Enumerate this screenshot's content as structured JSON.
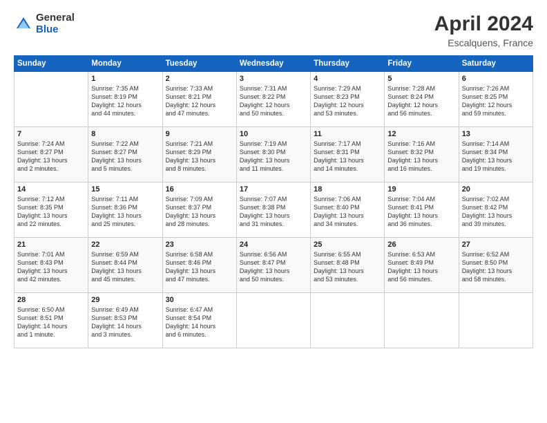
{
  "header": {
    "logo_general": "General",
    "logo_blue": "Blue",
    "month_title": "April 2024",
    "location": "Escalquens, France"
  },
  "days_of_week": [
    "Sunday",
    "Monday",
    "Tuesday",
    "Wednesday",
    "Thursday",
    "Friday",
    "Saturday"
  ],
  "weeks": [
    [
      {
        "day": "",
        "info": ""
      },
      {
        "day": "1",
        "info": "Sunrise: 7:35 AM\nSunset: 8:19 PM\nDaylight: 12 hours\nand 44 minutes."
      },
      {
        "day": "2",
        "info": "Sunrise: 7:33 AM\nSunset: 8:21 PM\nDaylight: 12 hours\nand 47 minutes."
      },
      {
        "day": "3",
        "info": "Sunrise: 7:31 AM\nSunset: 8:22 PM\nDaylight: 12 hours\nand 50 minutes."
      },
      {
        "day": "4",
        "info": "Sunrise: 7:29 AM\nSunset: 8:23 PM\nDaylight: 12 hours\nand 53 minutes."
      },
      {
        "day": "5",
        "info": "Sunrise: 7:28 AM\nSunset: 8:24 PM\nDaylight: 12 hours\nand 56 minutes."
      },
      {
        "day": "6",
        "info": "Sunrise: 7:26 AM\nSunset: 8:25 PM\nDaylight: 12 hours\nand 59 minutes."
      }
    ],
    [
      {
        "day": "7",
        "info": "Sunrise: 7:24 AM\nSunset: 8:27 PM\nDaylight: 13 hours\nand 2 minutes."
      },
      {
        "day": "8",
        "info": "Sunrise: 7:22 AM\nSunset: 8:27 PM\nDaylight: 13 hours\nand 5 minutes."
      },
      {
        "day": "9",
        "info": "Sunrise: 7:21 AM\nSunset: 8:29 PM\nDaylight: 13 hours\nand 8 minutes."
      },
      {
        "day": "10",
        "info": "Sunrise: 7:19 AM\nSunset: 8:30 PM\nDaylight: 13 hours\nand 11 minutes."
      },
      {
        "day": "11",
        "info": "Sunrise: 7:17 AM\nSunset: 8:31 PM\nDaylight: 13 hours\nand 14 minutes."
      },
      {
        "day": "12",
        "info": "Sunrise: 7:16 AM\nSunset: 8:32 PM\nDaylight: 13 hours\nand 16 minutes."
      },
      {
        "day": "13",
        "info": "Sunrise: 7:14 AM\nSunset: 8:34 PM\nDaylight: 13 hours\nand 19 minutes."
      }
    ],
    [
      {
        "day": "14",
        "info": "Sunrise: 7:12 AM\nSunset: 8:35 PM\nDaylight: 13 hours\nand 22 minutes."
      },
      {
        "day": "15",
        "info": "Sunrise: 7:11 AM\nSunset: 8:36 PM\nDaylight: 13 hours\nand 25 minutes."
      },
      {
        "day": "16",
        "info": "Sunrise: 7:09 AM\nSunset: 8:37 PM\nDaylight: 13 hours\nand 28 minutes."
      },
      {
        "day": "17",
        "info": "Sunrise: 7:07 AM\nSunset: 8:38 PM\nDaylight: 13 hours\nand 31 minutes."
      },
      {
        "day": "18",
        "info": "Sunrise: 7:06 AM\nSunset: 8:40 PM\nDaylight: 13 hours\nand 34 minutes."
      },
      {
        "day": "19",
        "info": "Sunrise: 7:04 AM\nSunset: 8:41 PM\nDaylight: 13 hours\nand 36 minutes."
      },
      {
        "day": "20",
        "info": "Sunrise: 7:02 AM\nSunset: 8:42 PM\nDaylight: 13 hours\nand 39 minutes."
      }
    ],
    [
      {
        "day": "21",
        "info": "Sunrise: 7:01 AM\nSunset: 8:43 PM\nDaylight: 13 hours\nand 42 minutes."
      },
      {
        "day": "22",
        "info": "Sunrise: 6:59 AM\nSunset: 8:44 PM\nDaylight: 13 hours\nand 45 minutes."
      },
      {
        "day": "23",
        "info": "Sunrise: 6:58 AM\nSunset: 8:46 PM\nDaylight: 13 hours\nand 47 minutes."
      },
      {
        "day": "24",
        "info": "Sunrise: 6:56 AM\nSunset: 8:47 PM\nDaylight: 13 hours\nand 50 minutes."
      },
      {
        "day": "25",
        "info": "Sunrise: 6:55 AM\nSunset: 8:48 PM\nDaylight: 13 hours\nand 53 minutes."
      },
      {
        "day": "26",
        "info": "Sunrise: 6:53 AM\nSunset: 8:49 PM\nDaylight: 13 hours\nand 56 minutes."
      },
      {
        "day": "27",
        "info": "Sunrise: 6:52 AM\nSunset: 8:50 PM\nDaylight: 13 hours\nand 58 minutes."
      }
    ],
    [
      {
        "day": "28",
        "info": "Sunrise: 6:50 AM\nSunset: 8:51 PM\nDaylight: 14 hours\nand 1 minute."
      },
      {
        "day": "29",
        "info": "Sunrise: 6:49 AM\nSunset: 8:53 PM\nDaylight: 14 hours\nand 3 minutes."
      },
      {
        "day": "30",
        "info": "Sunrise: 6:47 AM\nSunset: 8:54 PM\nDaylight: 14 hours\nand 6 minutes."
      },
      {
        "day": "",
        "info": ""
      },
      {
        "day": "",
        "info": ""
      },
      {
        "day": "",
        "info": ""
      },
      {
        "day": "",
        "info": ""
      }
    ]
  ]
}
